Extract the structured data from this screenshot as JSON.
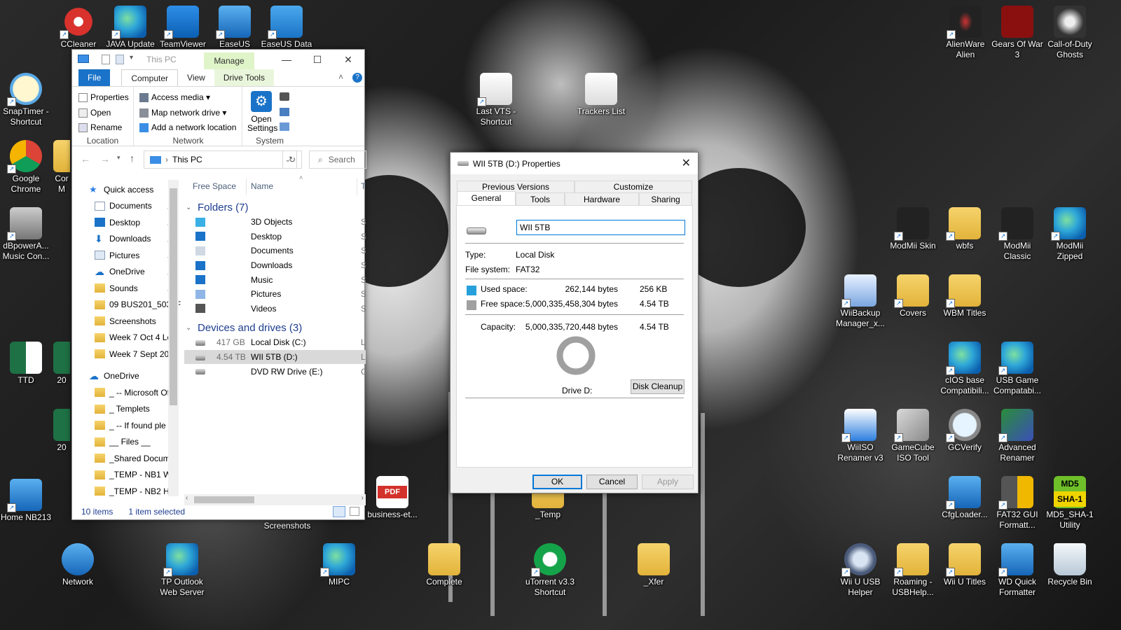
{
  "desktop": {
    "icons": [
      {
        "label": "CCleaner"
      },
      {
        "label": "JAVA Update"
      },
      {
        "label": "TeamViewer"
      },
      {
        "label": "EaseUS"
      },
      {
        "label": "EaseUS Data"
      },
      {
        "label": "SnapTimer - Shortcut"
      },
      {
        "label": "Google Chrome"
      },
      {
        "label": "dBpowerA... Music Con..."
      },
      {
        "label": "TTD"
      },
      {
        "label": "Home NB213"
      },
      {
        "label": "Network"
      },
      {
        "label": "TP Outlook Web Server"
      },
      {
        "label": "MIPC"
      },
      {
        "label": "Complete"
      },
      {
        "label": "uTorrent v3.3 Shortcut"
      },
      {
        "label": "_Xfer"
      },
      {
        "label": "Last VTS - Shortcut"
      },
      {
        "label": "Trackers List"
      },
      {
        "label": "business-et..."
      },
      {
        "label": "_Temp"
      },
      {
        "label": "Screenshots"
      },
      {
        "label": "AlienWare Alien"
      },
      {
        "label": "Gears Of War 3"
      },
      {
        "label": "Call-of-Duty Ghosts"
      },
      {
        "label": "ModMii Skin"
      },
      {
        "label": "wbfs"
      },
      {
        "label": "ModMii Classic"
      },
      {
        "label": "ModMii Zipped"
      },
      {
        "label": "WiiBackup Manager_x..."
      },
      {
        "label": "Covers"
      },
      {
        "label": "WBM Titles"
      },
      {
        "label": "cIOS base Compatibili..."
      },
      {
        "label": "USB Game Compatabi..."
      },
      {
        "label": "WiiISO Renamer v3"
      },
      {
        "label": "GameCube ISO Tool"
      },
      {
        "label": "GCVerify"
      },
      {
        "label": "Advanced Renamer"
      },
      {
        "label": "CfgLoader..."
      },
      {
        "label": "FAT32 GUI Formatt..."
      },
      {
        "label": "MD5_SHA-1 Utility"
      },
      {
        "label": "Wii U USB Helper"
      },
      {
        "label": "Roaming - USBHelp..."
      },
      {
        "label": "Wii U Titles"
      },
      {
        "label": "WD Quick Formatter"
      },
      {
        "label": "Recycle Bin"
      },
      {
        "label": "Cor M"
      },
      {
        "label": "20"
      },
      {
        "label": "20"
      }
    ],
    "md5_badge_top": "MD5",
    "md5_badge_bottom": "SHA-1",
    "pdf_badge": "PDF"
  },
  "explorer": {
    "title": "This PC",
    "manage_tab": "Manage",
    "window_buttons": {
      "minimize": "—",
      "maximize": "☐",
      "close": "✕"
    },
    "ribbon_tabs": [
      "File",
      "Computer",
      "View",
      "Drive Tools"
    ],
    "ribbon": {
      "location": {
        "label": "Location",
        "items": [
          "Properties",
          "Open",
          "Rename"
        ]
      },
      "network": {
        "label": "Network",
        "items": [
          "Access media ▾",
          "Map network drive ▾",
          "Add a network location"
        ]
      },
      "system": {
        "label": "System",
        "open_settings": "Open Settings"
      }
    },
    "address": {
      "path": "This PC",
      "search_placeholder": "Search"
    },
    "nav": [
      {
        "label": "Quick access",
        "kind": "star"
      },
      {
        "label": "Documents",
        "kind": "doc",
        "pinned": true
      },
      {
        "label": "Desktop",
        "kind": "desk",
        "pinned": true
      },
      {
        "label": "Downloads",
        "kind": "down",
        "pinned": true
      },
      {
        "label": "Pictures",
        "kind": "pic",
        "pinned": true
      },
      {
        "label": "OneDrive",
        "kind": "cloud",
        "pinned": true
      },
      {
        "label": "Sounds",
        "kind": "folder",
        "pinned": true
      },
      {
        "label": "09 BUS201_503_F",
        "kind": "folder"
      },
      {
        "label": "Screenshots",
        "kind": "folder"
      },
      {
        "label": "Week 7 Oct 4 Le",
        "kind": "folder"
      },
      {
        "label": "Week 7 Sept 20 L",
        "kind": "folder"
      },
      {
        "label": "OneDrive",
        "kind": "cloud"
      },
      {
        "label": "_ -- Microsoft Of",
        "kind": "folder"
      },
      {
        "label": "_ Templets",
        "kind": "folder"
      },
      {
        "label": "_ -- If found ple",
        "kind": "folder"
      },
      {
        "label": "__ Files __",
        "kind": "folder"
      },
      {
        "label": "_Shared Docume",
        "kind": "folder"
      },
      {
        "label": "_TEMP - NB1 Wo",
        "kind": "folder"
      },
      {
        "label": "_TEMP - NB2 Ho",
        "kind": "folder"
      }
    ],
    "columns": {
      "free_space": "Free Space",
      "name": "Name",
      "type": "T"
    },
    "folders_header": "Folders (7)",
    "folders": [
      "3D Objects",
      "Desktop",
      "Documents",
      "Downloads",
      "Music",
      "Pictures",
      "Videos"
    ],
    "devices_header": "Devices and drives (3)",
    "drives": [
      {
        "free": "417 GB",
        "name": "Local Disk (C:)",
        "t": "L"
      },
      {
        "free": "4.54 TB",
        "name": "WII 5TB (D:)",
        "t": "L",
        "selected": true
      },
      {
        "free": "",
        "name": "DVD RW Drive (E:)",
        "t": "C"
      }
    ],
    "status": {
      "items": "10 items",
      "selected": "1 item selected"
    }
  },
  "properties": {
    "title": "WII 5TB (D:) Properties",
    "tabs_row1": [
      "Previous Versions",
      "Customize"
    ],
    "tabs_row2": [
      "General",
      "Tools",
      "Hardware",
      "Sharing"
    ],
    "volume_name": "WII 5TB",
    "type_label": "Type:",
    "type_value": "Local Disk",
    "fs_label": "File system:",
    "fs_value": "FAT32",
    "used_label": "Used space:",
    "used_bytes": "262,144 bytes",
    "used_short": "256 KB",
    "free_label": "Free space:",
    "free_bytes": "5,000,335,458,304 bytes",
    "free_short": "4.54 TB",
    "capacity_label": "Capacity:",
    "capacity_bytes": "5,000,335,720,448 bytes",
    "capacity_short": "4.54 TB",
    "drive_label": "Drive D:",
    "disk_cleanup": "Disk Cleanup",
    "ok": "OK",
    "cancel": "Cancel",
    "apply": "Apply",
    "used_color": "#26a0da",
    "free_color": "#a0a0a0"
  }
}
